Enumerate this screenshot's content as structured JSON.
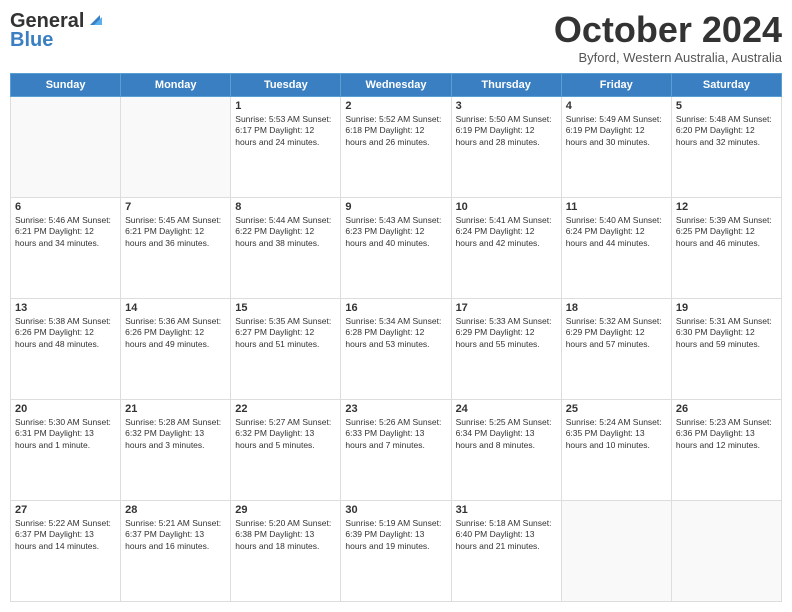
{
  "logo": {
    "line1": "General",
    "line2": "Blue"
  },
  "header": {
    "month_title": "October 2024",
    "subtitle": "Byford, Western Australia, Australia"
  },
  "days_of_week": [
    "Sunday",
    "Monday",
    "Tuesday",
    "Wednesday",
    "Thursday",
    "Friday",
    "Saturday"
  ],
  "weeks": [
    [
      {
        "day": "",
        "info": ""
      },
      {
        "day": "",
        "info": ""
      },
      {
        "day": "1",
        "info": "Sunrise: 5:53 AM\nSunset: 6:17 PM\nDaylight: 12 hours and 24 minutes."
      },
      {
        "day": "2",
        "info": "Sunrise: 5:52 AM\nSunset: 6:18 PM\nDaylight: 12 hours and 26 minutes."
      },
      {
        "day": "3",
        "info": "Sunrise: 5:50 AM\nSunset: 6:19 PM\nDaylight: 12 hours and 28 minutes."
      },
      {
        "day": "4",
        "info": "Sunrise: 5:49 AM\nSunset: 6:19 PM\nDaylight: 12 hours and 30 minutes."
      },
      {
        "day": "5",
        "info": "Sunrise: 5:48 AM\nSunset: 6:20 PM\nDaylight: 12 hours and 32 minutes."
      }
    ],
    [
      {
        "day": "6",
        "info": "Sunrise: 5:46 AM\nSunset: 6:21 PM\nDaylight: 12 hours and 34 minutes."
      },
      {
        "day": "7",
        "info": "Sunrise: 5:45 AM\nSunset: 6:21 PM\nDaylight: 12 hours and 36 minutes."
      },
      {
        "day": "8",
        "info": "Sunrise: 5:44 AM\nSunset: 6:22 PM\nDaylight: 12 hours and 38 minutes."
      },
      {
        "day": "9",
        "info": "Sunrise: 5:43 AM\nSunset: 6:23 PM\nDaylight: 12 hours and 40 minutes."
      },
      {
        "day": "10",
        "info": "Sunrise: 5:41 AM\nSunset: 6:24 PM\nDaylight: 12 hours and 42 minutes."
      },
      {
        "day": "11",
        "info": "Sunrise: 5:40 AM\nSunset: 6:24 PM\nDaylight: 12 hours and 44 minutes."
      },
      {
        "day": "12",
        "info": "Sunrise: 5:39 AM\nSunset: 6:25 PM\nDaylight: 12 hours and 46 minutes."
      }
    ],
    [
      {
        "day": "13",
        "info": "Sunrise: 5:38 AM\nSunset: 6:26 PM\nDaylight: 12 hours and 48 minutes."
      },
      {
        "day": "14",
        "info": "Sunrise: 5:36 AM\nSunset: 6:26 PM\nDaylight: 12 hours and 49 minutes."
      },
      {
        "day": "15",
        "info": "Sunrise: 5:35 AM\nSunset: 6:27 PM\nDaylight: 12 hours and 51 minutes."
      },
      {
        "day": "16",
        "info": "Sunrise: 5:34 AM\nSunset: 6:28 PM\nDaylight: 12 hours and 53 minutes."
      },
      {
        "day": "17",
        "info": "Sunrise: 5:33 AM\nSunset: 6:29 PM\nDaylight: 12 hours and 55 minutes."
      },
      {
        "day": "18",
        "info": "Sunrise: 5:32 AM\nSunset: 6:29 PM\nDaylight: 12 hours and 57 minutes."
      },
      {
        "day": "19",
        "info": "Sunrise: 5:31 AM\nSunset: 6:30 PM\nDaylight: 12 hours and 59 minutes."
      }
    ],
    [
      {
        "day": "20",
        "info": "Sunrise: 5:30 AM\nSunset: 6:31 PM\nDaylight: 13 hours and 1 minute."
      },
      {
        "day": "21",
        "info": "Sunrise: 5:28 AM\nSunset: 6:32 PM\nDaylight: 13 hours and 3 minutes."
      },
      {
        "day": "22",
        "info": "Sunrise: 5:27 AM\nSunset: 6:32 PM\nDaylight: 13 hours and 5 minutes."
      },
      {
        "day": "23",
        "info": "Sunrise: 5:26 AM\nSunset: 6:33 PM\nDaylight: 13 hours and 7 minutes."
      },
      {
        "day": "24",
        "info": "Sunrise: 5:25 AM\nSunset: 6:34 PM\nDaylight: 13 hours and 8 minutes."
      },
      {
        "day": "25",
        "info": "Sunrise: 5:24 AM\nSunset: 6:35 PM\nDaylight: 13 hours and 10 minutes."
      },
      {
        "day": "26",
        "info": "Sunrise: 5:23 AM\nSunset: 6:36 PM\nDaylight: 13 hours and 12 minutes."
      }
    ],
    [
      {
        "day": "27",
        "info": "Sunrise: 5:22 AM\nSunset: 6:37 PM\nDaylight: 13 hours and 14 minutes."
      },
      {
        "day": "28",
        "info": "Sunrise: 5:21 AM\nSunset: 6:37 PM\nDaylight: 13 hours and 16 minutes."
      },
      {
        "day": "29",
        "info": "Sunrise: 5:20 AM\nSunset: 6:38 PM\nDaylight: 13 hours and 18 minutes."
      },
      {
        "day": "30",
        "info": "Sunrise: 5:19 AM\nSunset: 6:39 PM\nDaylight: 13 hours and 19 minutes."
      },
      {
        "day": "31",
        "info": "Sunrise: 5:18 AM\nSunset: 6:40 PM\nDaylight: 13 hours and 21 minutes."
      },
      {
        "day": "",
        "info": ""
      },
      {
        "day": "",
        "info": ""
      }
    ]
  ]
}
